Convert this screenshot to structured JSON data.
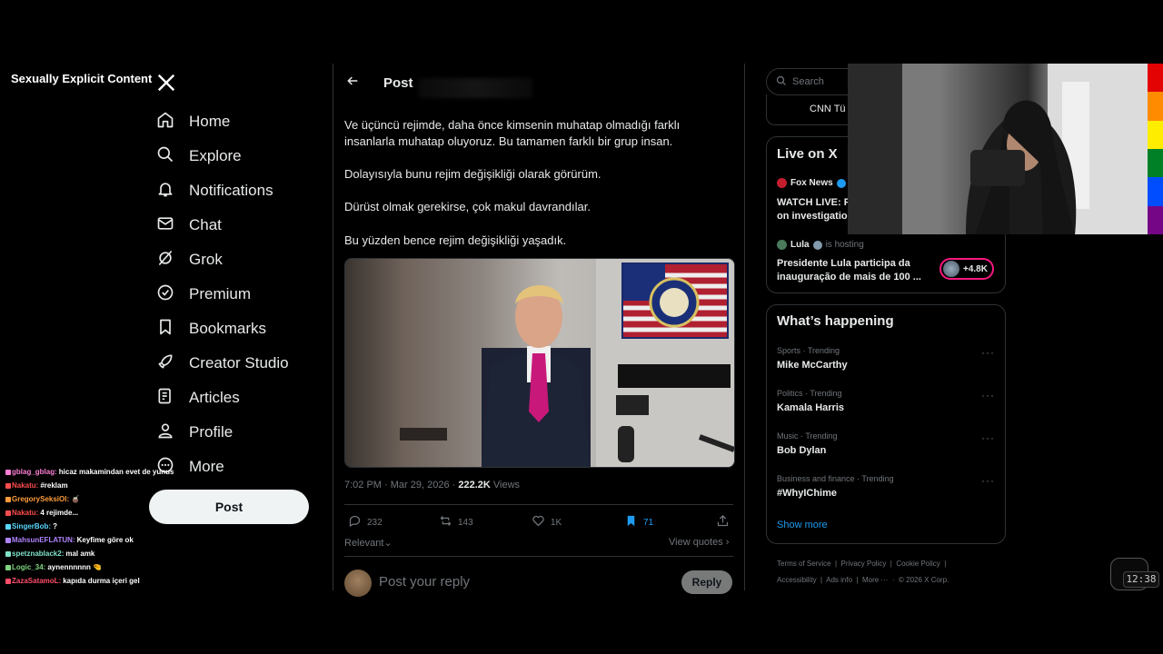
{
  "overlay_label": "Sexually Explicit Content",
  "nav": {
    "items": [
      {
        "label": "Home",
        "icon": "home-icon"
      },
      {
        "label": "Explore",
        "icon": "search-icon"
      },
      {
        "label": "Notifications",
        "icon": "bell-icon"
      },
      {
        "label": "Chat",
        "icon": "mail-icon"
      },
      {
        "label": "Grok",
        "icon": "grok-icon"
      },
      {
        "label": "Premium",
        "icon": "premium-icon"
      },
      {
        "label": "Bookmarks",
        "icon": "bookmark-icon"
      },
      {
        "label": "Creator Studio",
        "icon": "rocket-icon"
      },
      {
        "label": "Articles",
        "icon": "article-icon"
      },
      {
        "label": "Profile",
        "icon": "person-icon"
      },
      {
        "label": "More",
        "icon": "more-icon"
      }
    ],
    "post_button": "Post"
  },
  "chat": [
    {
      "user": "gblag_gblag:",
      "msg": "hicaz makamindan evet de yunus",
      "color": "#ff7fd4"
    },
    {
      "user": "Nakatu:",
      "msg": "#reklam",
      "color": "#ff4d4d"
    },
    {
      "user": "GregorySeksiOl:",
      "msg": "🧉",
      "color": "#ff9c3a"
    },
    {
      "user": "Nakatu:",
      "msg": "4 rejimde...",
      "color": "#ff4d4d"
    },
    {
      "user": "SingerBob:",
      "msg": "?",
      "color": "#5ad8ff"
    },
    {
      "user": "MahsunEFLATUN:",
      "msg": "Keyfime göre ok",
      "color": "#b084ff"
    },
    {
      "user": "spetznablack2:",
      "msg": "mal amk",
      "color": "#7fe3c8"
    },
    {
      "user": "Logic_34:",
      "msg": "aynennnnnn 🤏",
      "color": "#7fd47f"
    },
    {
      "user": "ZazaSatamoL:",
      "msg": "kapıda durma içeri gel",
      "color": "#ff4d6a"
    }
  ],
  "post": {
    "header_title": "Post",
    "paragraphs": [
      "Ve üçüncü rejimde, daha önce kimsenin muhatap olmadığı farklı insanlarla muhatap oluyoruz. Bu tamamen farklı bir grup insan.",
      "Dolayısıyla bunu rejim değişikliği olarak görürüm.",
      "Dürüst olmak gerekirse, çok makul davrandılar.",
      "Bu yüzden bence rejim değişikliği yaşadık."
    ],
    "timestamp": "7:02 PM · Mar 29, 2026 · ",
    "views_count": "222.2K",
    "views_label": " Views",
    "stats": {
      "replies": "232",
      "reposts": "143",
      "likes": "1K",
      "bookmarks": "71"
    },
    "relevant_label": "Relevant",
    "view_quotes_label": "View quotes",
    "reply_placeholder": "Post your reply",
    "reply_button": "Reply"
  },
  "right": {
    "search_placeholder": "Search",
    "cnn_label": "CNN Tü",
    "live_title": "Live on X",
    "live": [
      {
        "source": "Fox News",
        "suffix": "",
        "headline1": "WATCH LIVE: F",
        "headline2": "on investigatio"
      },
      {
        "source": "Lula",
        "suffix": "is hosting",
        "headline1": "Presidente Lula participa da",
        "headline2": "inauguração de mais de 100 ..."
      }
    ],
    "host_count": "+4.8K",
    "happening_title": "What’s happening",
    "trends": [
      {
        "category": "Sports · Trending",
        "name": "Mike McCarthy"
      },
      {
        "category": "Politics · Trending",
        "name": "Kamala Harris"
      },
      {
        "category": "Music · Trending",
        "name": "Bob Dylan"
      },
      {
        "category": "Business and finance · Trending",
        "name": "#WhyIChime"
      }
    ],
    "show_more": "Show more",
    "footer_row1": [
      "Terms of Service",
      "Privacy Policy",
      "Cookie Policy"
    ],
    "footer_row2": [
      "Accessibility",
      "Ads info",
      "More ···",
      "© 2026 X Corp."
    ]
  },
  "clock": "12:38",
  "colors": {
    "accent": "#1d9bf0",
    "live_ring": "#f91880",
    "bg": "#000000"
  }
}
